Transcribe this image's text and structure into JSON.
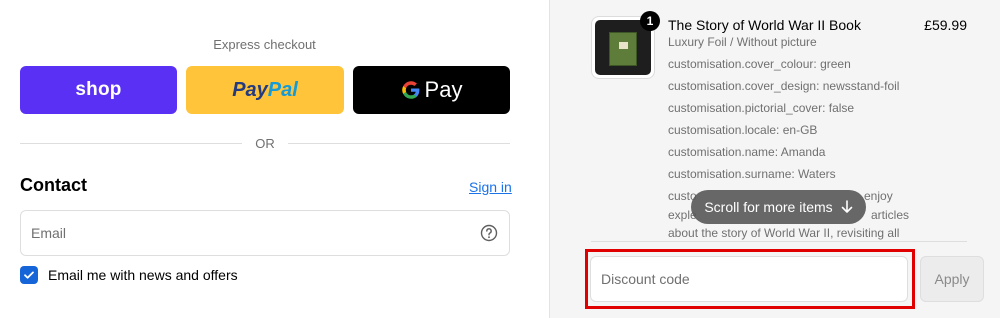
{
  "express": {
    "label": "Express checkout",
    "shop_label": "shop",
    "paypal_part1": "Pay",
    "paypal_part2": "Pal",
    "gpay_label": "Pay"
  },
  "divider_text": "OR",
  "contact": {
    "title": "Contact",
    "signin_label": "Sign in",
    "email_placeholder": "Email",
    "newsletter_label": "Email me with news and offers",
    "newsletter_checked": true
  },
  "cart": {
    "item": {
      "quantity": "1",
      "title": "The Story of World War II Book",
      "price": "£59.99",
      "variant": "Luxury Foil / Without picture",
      "customisations": [
        "customisation.cover_colour: green",
        "customisation.cover_design: newsstand-foil",
        "customisation.pictorial_cover: false",
        "customisation.locale: en-GB",
        "customisation.name: Amanda",
        "customisation.surname: Waters"
      ],
      "description_line1_left": "custo",
      "description_line1_right": "enjoy",
      "description_line2_left": "exple",
      "description_line2_right": "articles",
      "description_line3": "about the story of World War II, revisiting all"
    },
    "scroll_hint": "Scroll for more items"
  },
  "discount": {
    "placeholder": "Discount code",
    "apply_label": "Apply"
  },
  "colors": {
    "shop": "#5a31f4",
    "paypal": "#ffc439",
    "gpay": "#000000",
    "checkbox": "#1565d8",
    "highlight": "#e10000",
    "link": "#1a73e8"
  }
}
